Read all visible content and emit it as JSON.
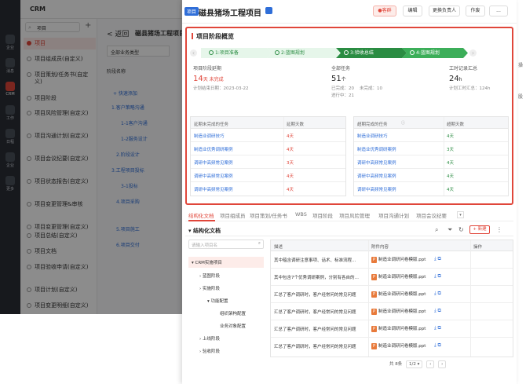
{
  "app": {
    "title": "CRM"
  },
  "leftbar": [
    {
      "label": "企业",
      "icon": "building-icon"
    },
    {
      "label": "消息",
      "icon": "message-icon"
    },
    {
      "label": "CRM",
      "icon": "crm-icon",
      "active": true
    },
    {
      "label": "工作",
      "icon": "work-icon"
    },
    {
      "label": "日程",
      "icon": "calendar-icon"
    },
    {
      "label": "企业",
      "icon": "enterprise-icon"
    },
    {
      "label": "更多",
      "icon": "more-icon"
    }
  ],
  "sidebar": {
    "search_value": "项目",
    "items": [
      "项目",
      "项目组成员(自定义)",
      "项目策划/任务书(自定义)",
      "项目阶段",
      "项目风险管理(自定义)",
      "项目沟通计划(自定义)",
      "项目会议纪要(自定义)",
      "项目状态报告(自定义)",
      "项目变更管理&审核",
      "项目变更管理(自定义)",
      "项目总结(自定义)",
      "项目文档",
      "项目验收申请(自定义)",
      "项目计划(自定义)",
      "项目变更明细(自定义)"
    ]
  },
  "mid": {
    "back": "< 返回",
    "title": "磁县猪场工程项目",
    "filter": "全部业务类型",
    "col": "阶段名称",
    "rows": [
      "+ 快速添加",
      "1.客户策略沟通",
      "1-1客户沟通",
      "1-2服务设计",
      "2.阶段设计",
      "3.工程项目投标",
      "3-1投标",
      "4.项目采购",
      "5.项目施工",
      "6.项目交付"
    ]
  },
  "drawer": {
    "tag": "项目",
    "title": "磁县猪场工程项目",
    "buttons": {
      "customer": "客群",
      "edit": "编辑",
      "owner": "更换负责人",
      "void": "作废",
      "more": "..."
    },
    "overview_title": "项目阶段概览",
    "steps": [
      "1:项目准备",
      "2:蓝图规划",
      "3:验收总结",
      "4:蓝图规划"
    ],
    "metrics": {
      "delay": {
        "label": "项目阶段延期",
        "value": "14",
        "unit": "天 未完成",
        "sub": "计划结束日期：2023-03-22"
      },
      "tasks": {
        "label": "全部任务",
        "value": "51",
        "unit": "个",
        "done": "已完成：20",
        "undone": "未完成：10",
        "ongoing": "进行中：21"
      },
      "hours": {
        "label": "工时记录汇总",
        "value": "24",
        "unit": "h",
        "sub": "计划工时汇总：124h"
      }
    },
    "delayed_table": {
      "h1": "延期未完成的任务",
      "h2": "延期天数",
      "rows": [
        {
          "task": "制造业调研技巧",
          "days": "4天"
        },
        {
          "task": "制造业优秀调研案例",
          "days": "4天"
        },
        {
          "task": "调研中高频常见案例",
          "days": "3天"
        },
        {
          "task": "调研中高频常见案例",
          "days": "4天"
        },
        {
          "task": "调研中高频常见案例",
          "days": "4天"
        }
      ]
    },
    "overdue_table": {
      "h1": "超期完成的任务",
      "h2": "超期天数",
      "rows": [
        {
          "task": "制造业调研技巧",
          "days": "4天"
        },
        {
          "task": "制造业优秀调研案例",
          "days": "3天"
        },
        {
          "task": "调研中高频常见案例",
          "days": "4天"
        },
        {
          "task": "调研中高频常见案例",
          "days": "4天"
        },
        {
          "task": "调研中高频常见案例",
          "days": "4天"
        }
      ]
    },
    "tabs": [
      "结构化文档",
      "项目组成员",
      "项目策划/任务书",
      "WBS",
      "项目阶段",
      "项目风险管理",
      "项目沟通计划",
      "项目会议纪要"
    ],
    "doc": {
      "title": "结构化文档",
      "new_btn": "+ 新建",
      "tree_search_placeholder": "请输入项目名",
      "tree": [
        "CRM实施项目",
        "蓝图阶段",
        "实施阶段",
        "功能配置",
        "组织架构配置",
        "业务对象配置",
        "上线阶段",
        "验收阶段"
      ],
      "grid_headers": [
        "描述",
        "附件内容",
        "操作"
      ],
      "rows": [
        {
          "desc": "其中蕴含调研注意事项、话术、标准流程…",
          "file": "制造业调研问卷模版.ppt"
        },
        {
          "desc": "其中包含7个优秀调研案例，分别有各自的…",
          "file": "制造业调研问卷模版.ppt"
        },
        {
          "desc": "汇总了客户调研时，客户经常问的常见问题",
          "file": "制造业调研问卷模版.ppt"
        },
        {
          "desc": "汇总了客户调研时，客户经常问的常见问题",
          "file": "制造业调研问卷模版.ppt"
        },
        {
          "desc": "汇总了客户调研时，客户经常问的常见问题",
          "file": "制造业调研问卷模版.ppt"
        },
        {
          "desc": "汇总了客户调研时，客户经常问的常见问题",
          "file": "制造业调研问卷模版.ppt"
        },
        {
          "desc": "汇总了客户调研时，客户经常问的常见问题",
          "file": "制造业调研问卷模版.ppt"
        }
      ],
      "pager": {
        "total": "共 8条",
        "page": "1/2 ▾"
      }
    }
  },
  "rightstrip": [
    "操",
    "股"
  ]
}
